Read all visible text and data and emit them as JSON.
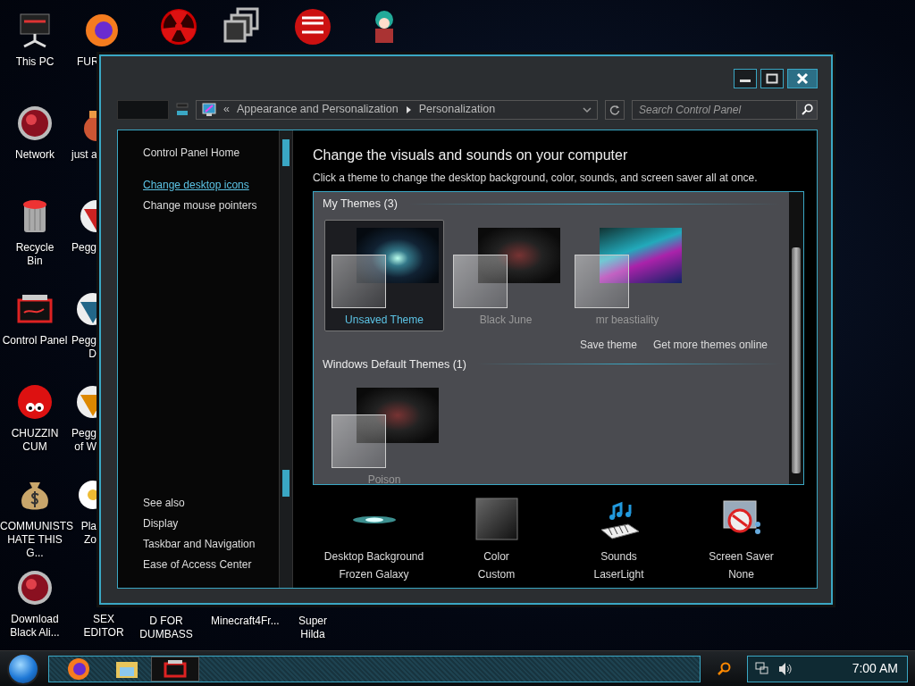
{
  "desktop_icons": [
    {
      "label": "This PC"
    },
    {
      "label": "FUR"
    },
    {
      "label": "Network"
    },
    {
      "label": "just a"
    },
    {
      "label": "Recycle Bin"
    },
    {
      "label": "Pegg"
    },
    {
      "label": "Control Panel"
    },
    {
      "label": "Pegg D"
    },
    {
      "label": "CHUZZIN CUM"
    },
    {
      "label": "Pegg of W"
    },
    {
      "label": "COMMUNISTS HATE THIS G..."
    },
    {
      "label": "Pla Zo"
    },
    {
      "label": "Download Black Ali..."
    },
    {
      "label": "SEX EDITOR"
    },
    {
      "label": "D FOR DUMBASS"
    },
    {
      "label": "Minecraft4Fr..."
    },
    {
      "label": "Super Hilda"
    }
  ],
  "window": {
    "address": {
      "chevron": "«",
      "breadcrumb": [
        "Appearance and Personalization",
        "Personalization"
      ],
      "search_placeholder": "Search Control Panel"
    },
    "sidebar": {
      "links": [
        {
          "label": "Control Panel Home",
          "hovered": false
        },
        {
          "label": "Change desktop icons",
          "hovered": true
        },
        {
          "label": "Change mouse pointers",
          "hovered": false
        }
      ],
      "see_also": {
        "heading": "See also",
        "links": [
          "Display",
          "Taskbar and Navigation",
          "Ease of Access Center"
        ]
      }
    },
    "title": "Change the visuals and sounds on your computer",
    "subtitle": "Click a theme to change the desktop background, color, sounds, and screen saver all at once.",
    "theme_groups": [
      {
        "heading": "My Themes (3)",
        "themes": [
          {
            "name": "Unsaved Theme",
            "selected": true
          },
          {
            "name": "Black June",
            "selected": false
          },
          {
            "name": "mr beastiality",
            "selected": false
          }
        ],
        "links": [
          "Save theme",
          "Get more themes online"
        ]
      },
      {
        "heading": "Windows Default Themes (1)",
        "themes": [
          {
            "name": "Poison",
            "selected": false
          }
        ]
      }
    ],
    "settings": [
      {
        "label": "Desktop Background",
        "value": "Frozen Galaxy"
      },
      {
        "label": "Color",
        "value": "Custom"
      },
      {
        "label": "Sounds",
        "value": "LaserLight"
      },
      {
        "label": "Screen Saver",
        "value": "None"
      }
    ]
  },
  "taskbar": {
    "tasks": [
      {
        "selected": false
      },
      {
        "selected": false
      },
      {
        "selected": true
      }
    ],
    "clock": "7:00 AM"
  }
}
